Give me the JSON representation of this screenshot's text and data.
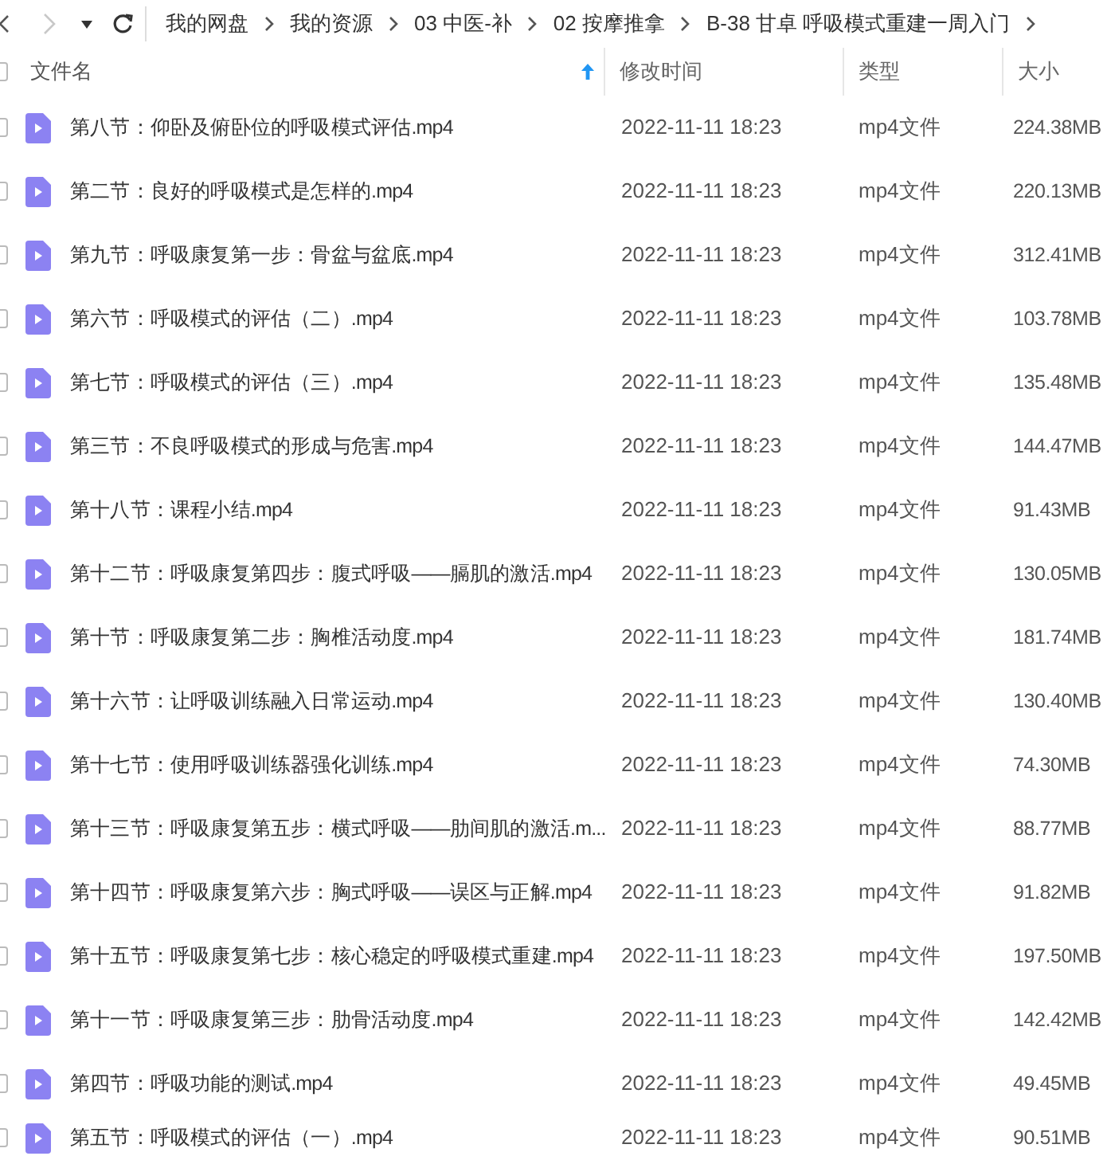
{
  "toolbar": {
    "back_disabled": false,
    "forward_disabled": true
  },
  "select_all": {
    "checked": false
  },
  "breadcrumbs": [
    "我的网盘",
    "我的资源",
    "03 中医-补",
    "02 按摩推拿",
    "B-38 甘卓 呼吸模式重建一周入门"
  ],
  "columns": [
    {
      "label": "文件名",
      "sorted": true
    },
    {
      "label": "修改时间",
      "sorted": false
    },
    {
      "label": "类型",
      "sorted": false
    },
    {
      "label": "大小",
      "sorted": false
    }
  ],
  "rows": [
    {
      "name": "第八节：仰卧及俯卧位的呼吸模式评估.mp4",
      "modified": "2022-11-11 18:23",
      "type": "mp4文件",
      "size": "224.38MB",
      "checked": false
    },
    {
      "name": "第二节：良好的呼吸模式是怎样的.mp4",
      "modified": "2022-11-11 18:23",
      "type": "mp4文件",
      "size": "220.13MB",
      "checked": false
    },
    {
      "name": "第九节：呼吸康复第一步：骨盆与盆底.mp4",
      "modified": "2022-11-11 18:23",
      "type": "mp4文件",
      "size": "312.41MB",
      "checked": false
    },
    {
      "name": "第六节：呼吸模式的评估（二）.mp4",
      "modified": "2022-11-11 18:23",
      "type": "mp4文件",
      "size": "103.78MB",
      "checked": false
    },
    {
      "name": "第七节：呼吸模式的评估（三）.mp4",
      "modified": "2022-11-11 18:23",
      "type": "mp4文件",
      "size": "135.48MB",
      "checked": false
    },
    {
      "name": "第三节：不良呼吸模式的形成与危害.mp4",
      "modified": "2022-11-11 18:23",
      "type": "mp4文件",
      "size": "144.47MB",
      "checked": false
    },
    {
      "name": "第十八节：课程小结.mp4",
      "modified": "2022-11-11 18:23",
      "type": "mp4文件",
      "size": "91.43MB",
      "checked": false
    },
    {
      "name": "第十二节：呼吸康复第四步：腹式呼吸——膈肌的激活.mp4",
      "modified": "2022-11-11 18:23",
      "type": "mp4文件",
      "size": "130.05MB",
      "checked": false
    },
    {
      "name": "第十节：呼吸康复第二步：胸椎活动度.mp4",
      "modified": "2022-11-11 18:23",
      "type": "mp4文件",
      "size": "181.74MB",
      "checked": false
    },
    {
      "name": "第十六节：让呼吸训练融入日常运动.mp4",
      "modified": "2022-11-11 18:23",
      "type": "mp4文件",
      "size": "130.40MB",
      "checked": false
    },
    {
      "name": "第十七节：使用呼吸训练器强化训练.mp4",
      "modified": "2022-11-11 18:23",
      "type": "mp4文件",
      "size": "74.30MB",
      "checked": false
    },
    {
      "name": "第十三节：呼吸康复第五步：横式呼吸——肋间肌的激活.m...",
      "modified": "2022-11-11 18:23",
      "type": "mp4文件",
      "size": "88.77MB",
      "checked": false
    },
    {
      "name": "第十四节：呼吸康复第六步：胸式呼吸——误区与正解.mp4",
      "modified": "2022-11-11 18:23",
      "type": "mp4文件",
      "size": "91.82MB",
      "checked": false
    },
    {
      "name": "第十五节：呼吸康复第七步：核心稳定的呼吸模式重建.mp4",
      "modified": "2022-11-11 18:23",
      "type": "mp4文件",
      "size": "197.50MB",
      "checked": false
    },
    {
      "name": "第十一节：呼吸康复第三步：肋骨活动度.mp4",
      "modified": "2022-11-11 18:23",
      "type": "mp4文件",
      "size": "142.42MB",
      "checked": false
    },
    {
      "name": "第四节：呼吸功能的测试.mp4",
      "modified": "2022-11-11 18:23",
      "type": "mp4文件",
      "size": "49.45MB",
      "checked": false
    },
    {
      "name": "第五节：呼吸模式的评估（一）.mp4",
      "modified": "2022-11-11 18:23",
      "type": "mp4文件",
      "size": "90.51MB",
      "checked": false
    }
  ]
}
